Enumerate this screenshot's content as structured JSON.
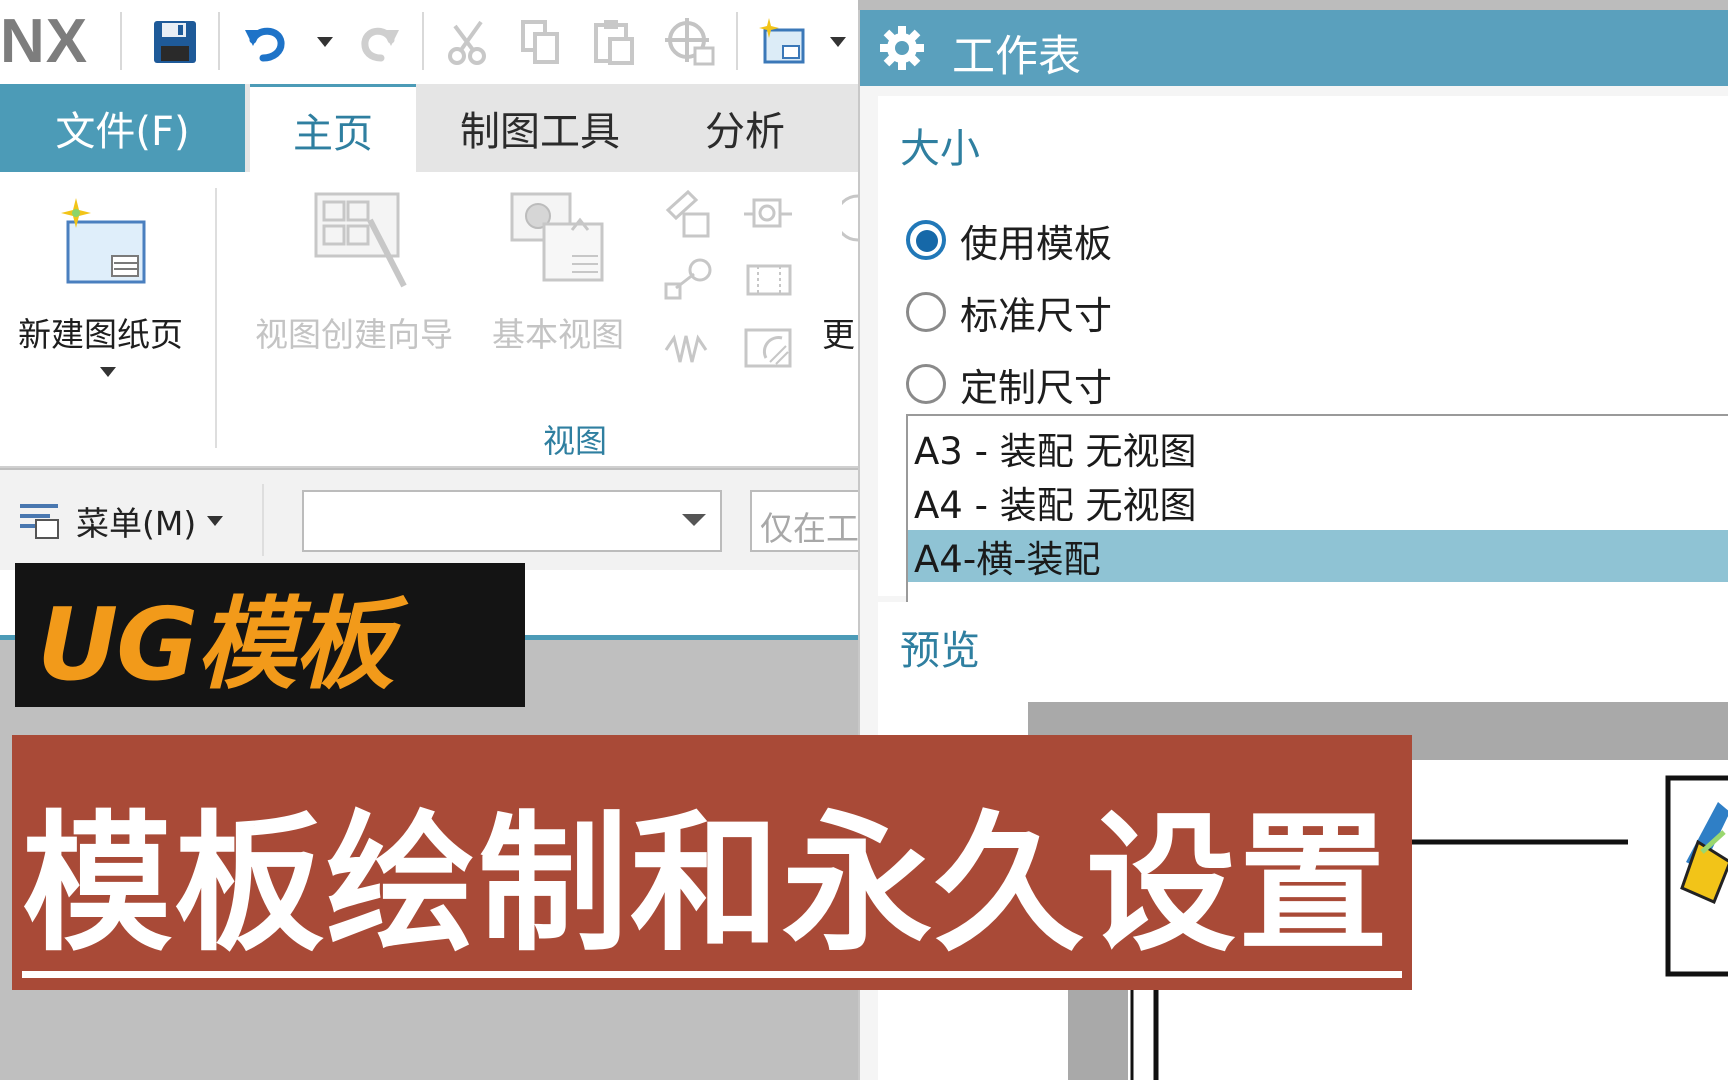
{
  "app": {
    "logo": "NX"
  },
  "tabs": {
    "file": "文件(F)",
    "home": "主页",
    "drafting_tools": "制图工具",
    "analysis": "分析"
  },
  "ribbon": {
    "new_sheet": "新建图纸页",
    "view_wizard": "视图创建向导",
    "base_view": "基本视图",
    "more": "更",
    "group_view": "视图"
  },
  "command_bar": {
    "menu": "菜单(M)",
    "filter_value": "",
    "search_placeholder": "仅在工"
  },
  "dialog": {
    "title": "工作表",
    "size_section": "大小",
    "options": [
      {
        "label": "使用模板",
        "selected": true
      },
      {
        "label": "标准尺寸",
        "selected": false
      },
      {
        "label": "定制尺寸",
        "selected": false
      }
    ],
    "templates": [
      {
        "label": "A3 - 装配 无视图",
        "selected": false
      },
      {
        "label": "A4 - 装配 无视图",
        "selected": false
      },
      {
        "label": "A4-横-装配",
        "selected": true
      }
    ],
    "preview_section": "预览"
  },
  "overlay": {
    "badge": "UG模板",
    "headline": "模板绘制和永久设置"
  },
  "colors": {
    "accent": "#4c9bb7",
    "dialog_title": "#5aa0bd",
    "selection": "#8fc3d4",
    "badge_text": "#f29a1a",
    "banner": "#a94a37"
  }
}
